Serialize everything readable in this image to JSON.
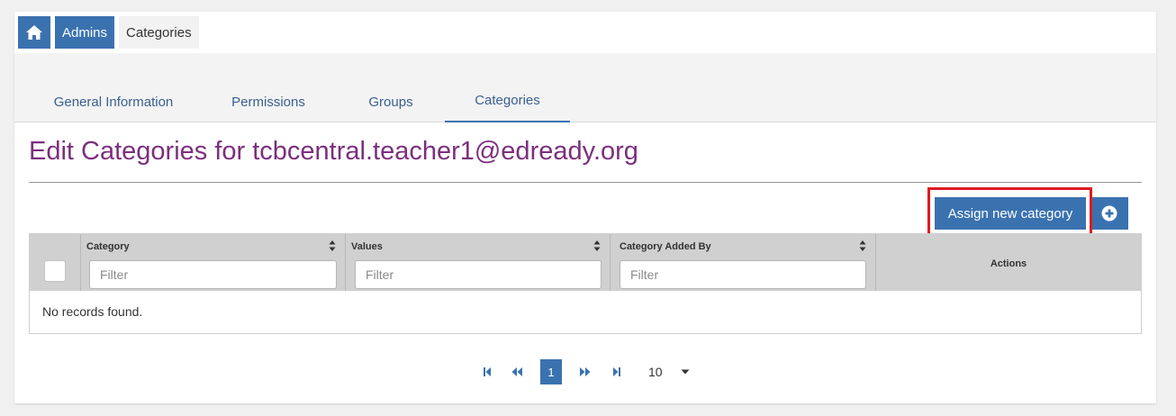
{
  "breadcrumb": {
    "home_icon": "home-icon",
    "admins": "Admins",
    "current": "Categories"
  },
  "tabs": [
    {
      "label": "General Information",
      "active": false
    },
    {
      "label": "Permissions",
      "active": false
    },
    {
      "label": "Groups",
      "active": false
    },
    {
      "label": "Categories",
      "active": true
    }
  ],
  "page": {
    "title": "Edit Categories for tcbcentral.teacher1@edready.org"
  },
  "toolbar": {
    "assign_label": "Assign new category",
    "add_icon": "plus-circle-icon"
  },
  "table": {
    "columns": [
      {
        "label": "Category",
        "filter_placeholder": "Filter"
      },
      {
        "label": "Values",
        "filter_placeholder": "Filter"
      },
      {
        "label": "Category Added By",
        "filter_placeholder": "Filter"
      }
    ],
    "actions_label": "Actions",
    "empty_message": "No records found."
  },
  "pagination": {
    "current_page": "1",
    "rows_per_page": "10"
  },
  "colors": {
    "primary": "#3a72b0",
    "title": "#7b2f7e",
    "highlight": "#e01a22",
    "header_bg": "#d0d0d0"
  }
}
